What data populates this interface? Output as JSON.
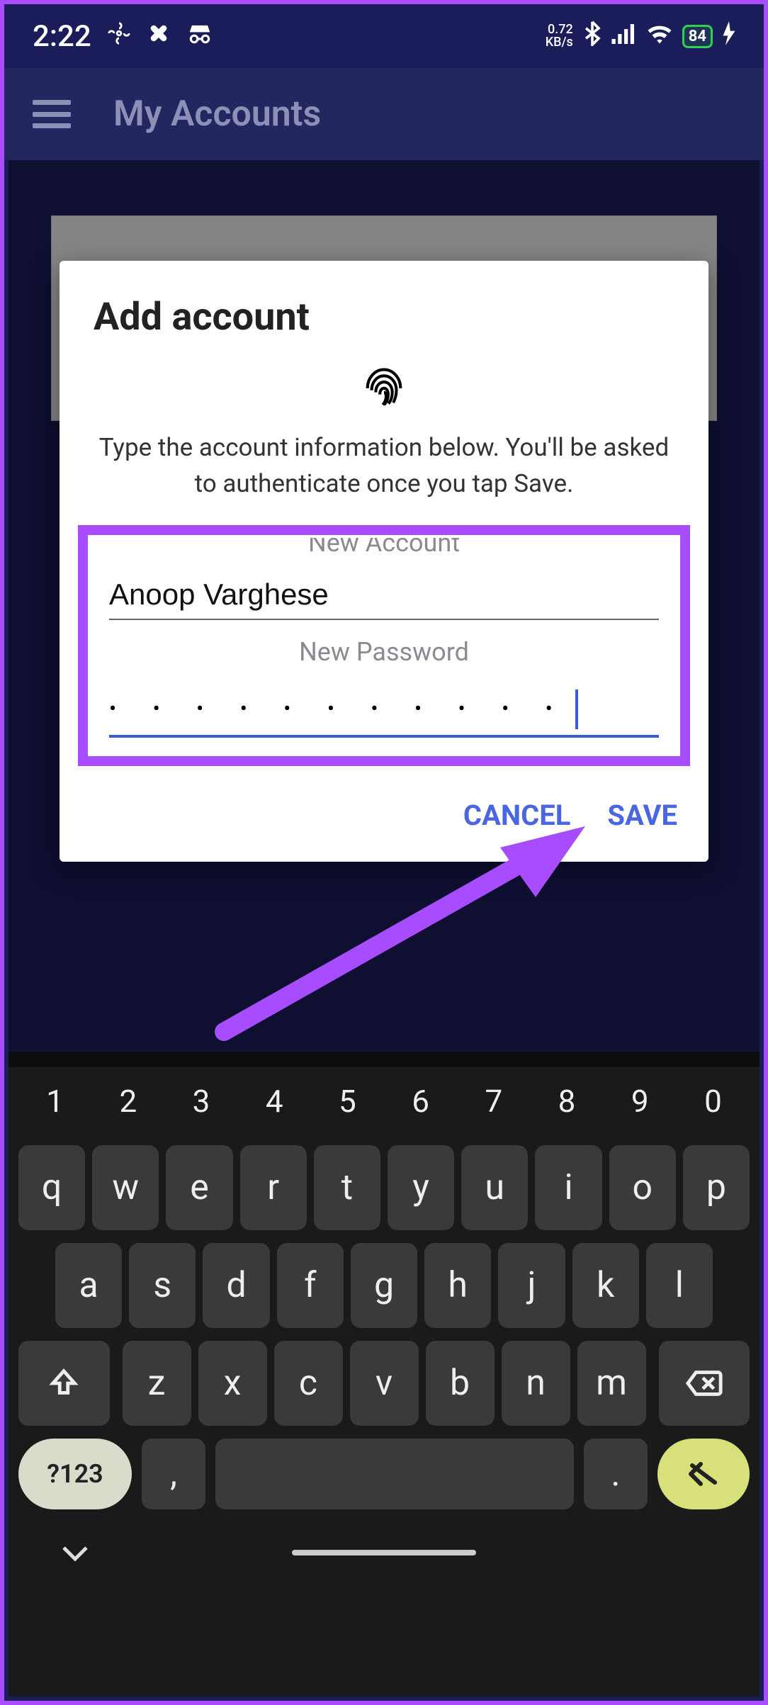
{
  "status": {
    "time": "2:22",
    "speed_top": "0.72",
    "speed_bottom": "KB/s",
    "battery": "84"
  },
  "appbar": {
    "title": "My Accounts"
  },
  "dialog": {
    "title": "Add account",
    "message": "Type the account information below. You'll be asked to authenticate once you tap Save.",
    "account_label": "New Account",
    "account_value": "Anoop Varghese",
    "password_label": "New Password",
    "password_mask": "• • • • • • • • • • •",
    "cancel": "CANCEL",
    "save": "SAVE"
  },
  "keyboard": {
    "numbers": [
      "1",
      "2",
      "3",
      "4",
      "5",
      "6",
      "7",
      "8",
      "9",
      "0"
    ],
    "row1": [
      "q",
      "w",
      "e",
      "r",
      "t",
      "y",
      "u",
      "i",
      "o",
      "p"
    ],
    "row2": [
      "a",
      "s",
      "d",
      "f",
      "g",
      "h",
      "j",
      "k",
      "l"
    ],
    "row3": [
      "z",
      "x",
      "c",
      "v",
      "b",
      "n",
      "m"
    ],
    "sym": "?123",
    "comma": ",",
    "dot": "."
  }
}
